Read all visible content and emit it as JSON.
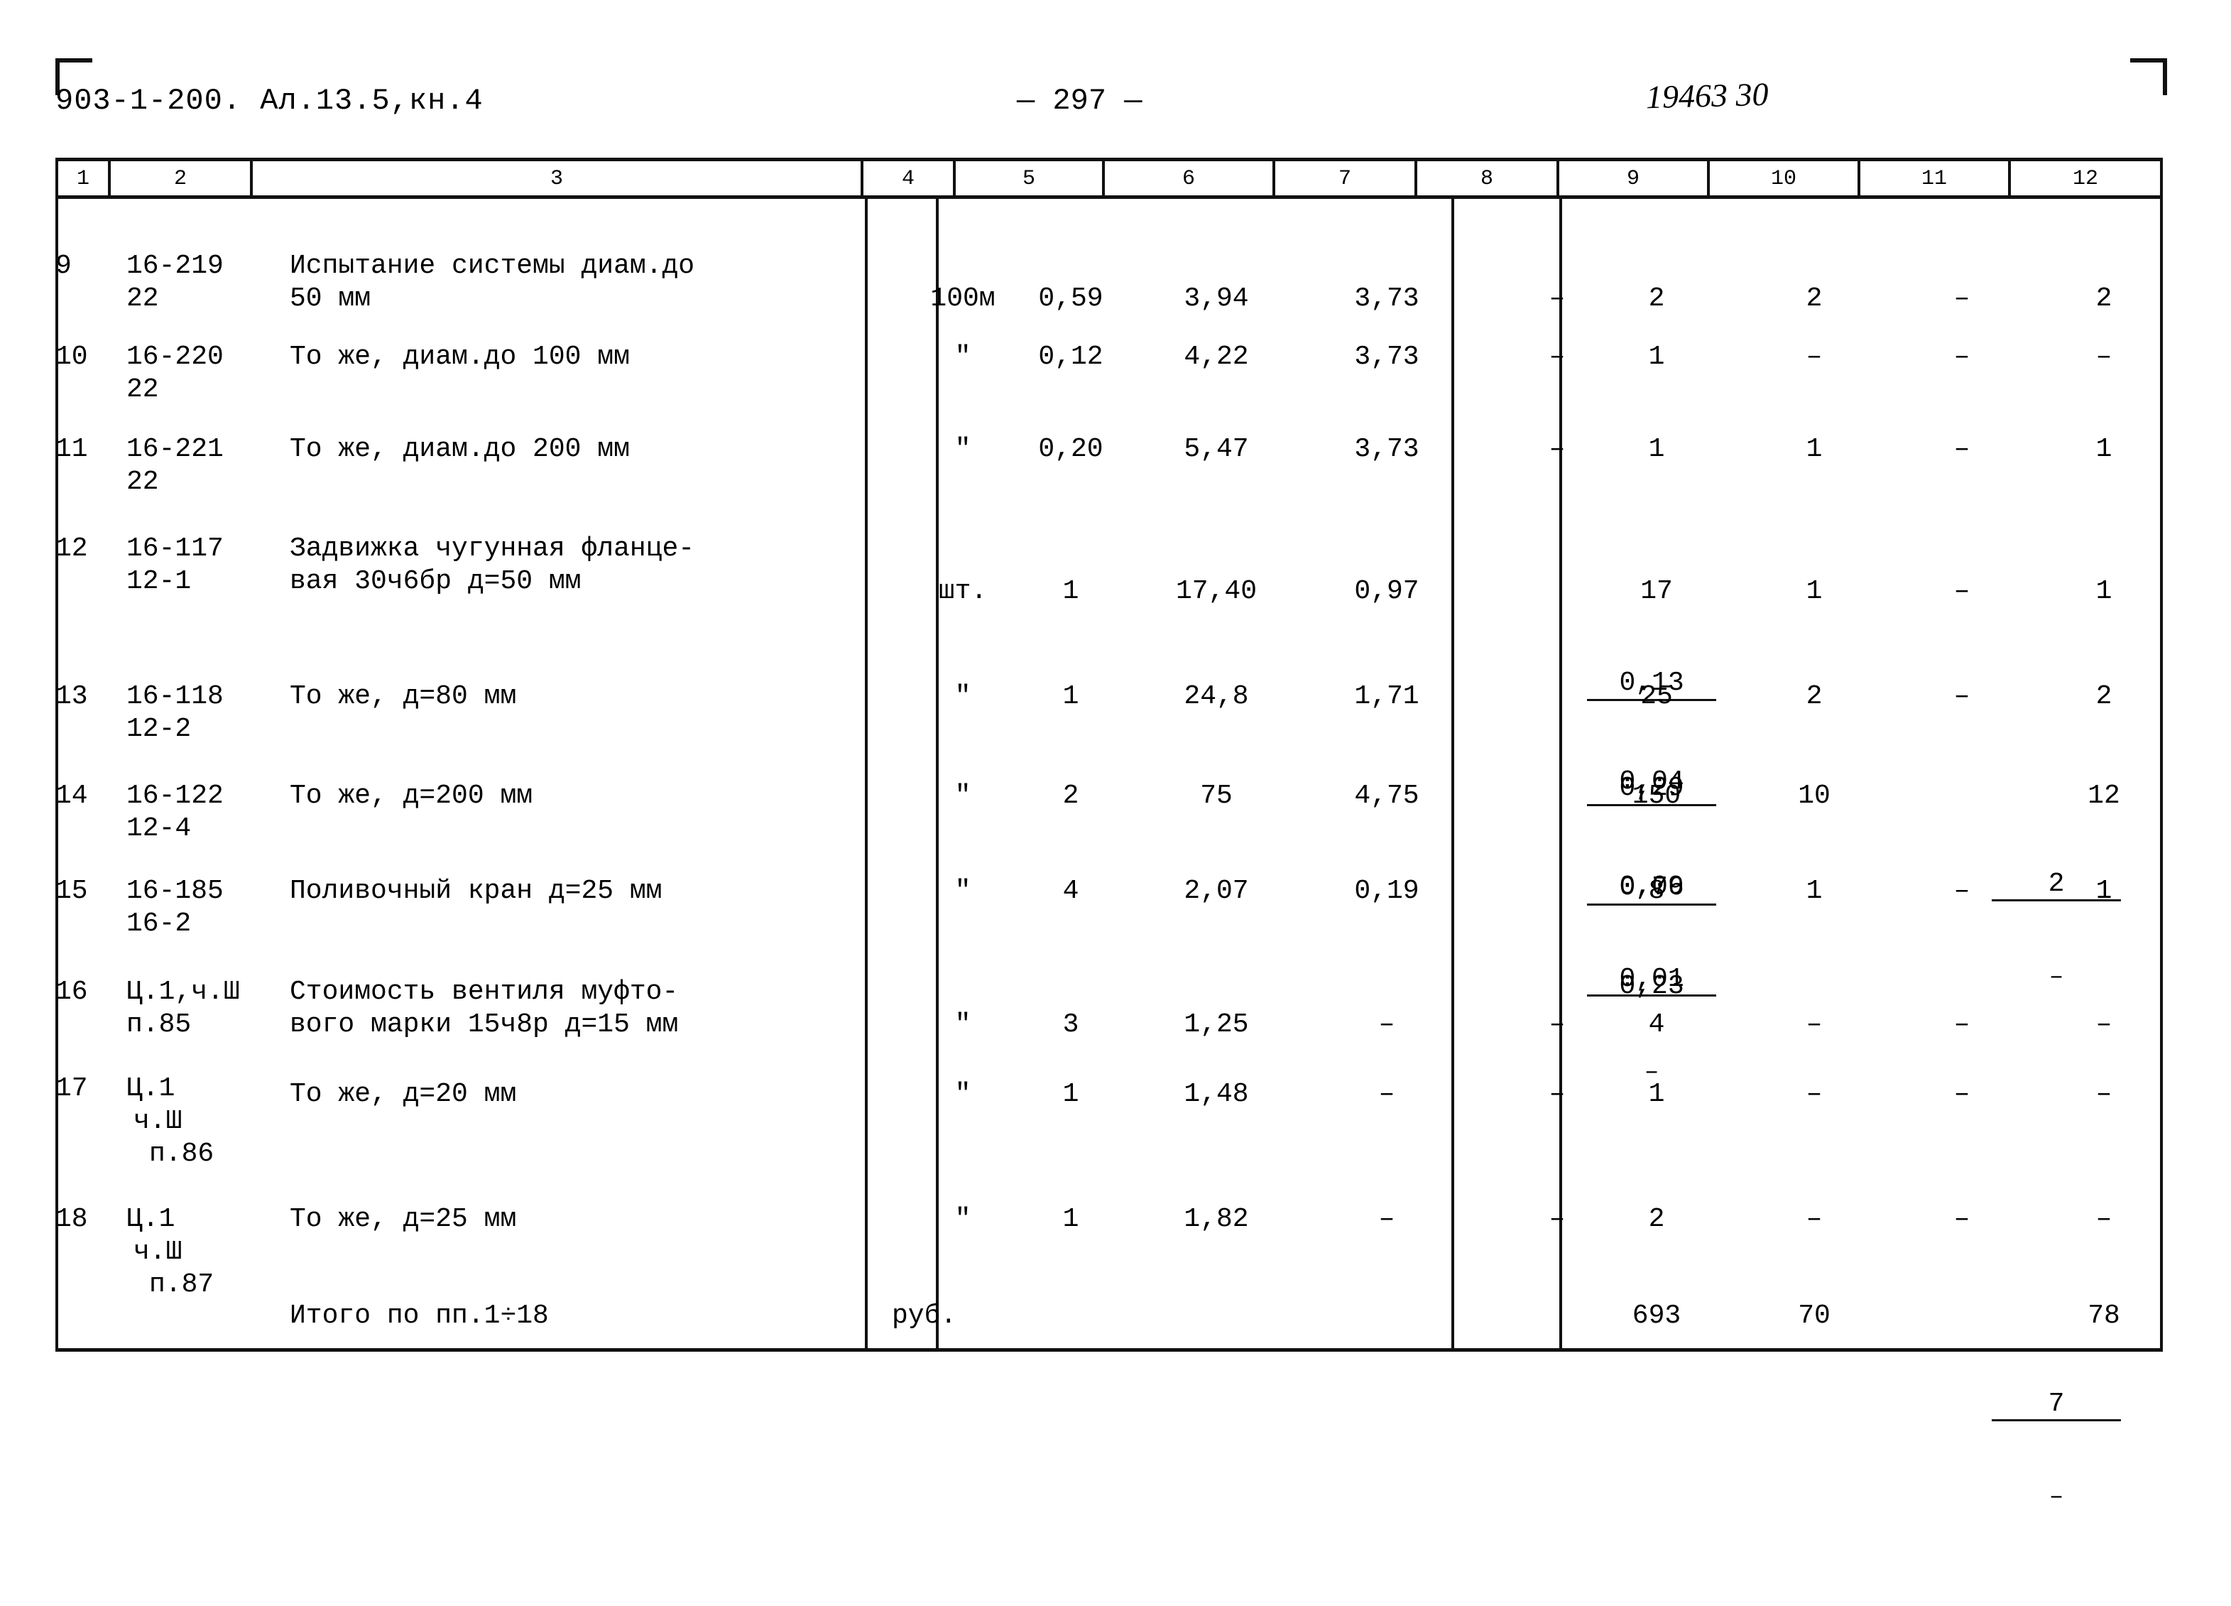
{
  "header": {
    "doc_code": "903-1-200. Ал.13.5,кн.4",
    "page_label": "— 297 —",
    "stamp": "19463 30"
  },
  "table": {
    "column_numbers": [
      "1",
      "2",
      "3",
      "4",
      "5",
      "6",
      "7",
      "8",
      "9",
      "10",
      "11",
      "12"
    ],
    "rows": [
      {
        "num": "9",
        "code_line1": "16-219",
        "code_line2": "22",
        "name_line1": "Испытание системы диам.до",
        "name_line2": "50 мм",
        "unit": "100м",
        "c5": "0,59",
        "c6": "3,94",
        "c7": "3,73",
        "c8_top": "",
        "c8_bot": "",
        "c8": "–",
        "c9": "2",
        "c10": "2",
        "c11": "–",
        "c12": "2"
      },
      {
        "num": "10",
        "code_line1": "16-220",
        "code_line2": "22",
        "name_line1": "То же, диам.до 100 мм",
        "name_line2": "",
        "unit": "\"",
        "c5": "0,12",
        "c6": "4,22",
        "c7": "3,73",
        "c8": "–",
        "c9": "1",
        "c10": "–",
        "c11": "–",
        "c12": "–"
      },
      {
        "num": "11",
        "code_line1": "16-221",
        "code_line2": "22",
        "name_line1": "То же, диам.до 200 мм",
        "name_line2": "",
        "unit": "\"",
        "c5": "0,20",
        "c6": "5,47",
        "c7": "3,73",
        "c8": "–",
        "c9": "1",
        "c10": "1",
        "c11": "–",
        "c12": "1"
      },
      {
        "num": "12",
        "code_line1": "16-117",
        "code_line2": "12-1",
        "name_line1": "Задвижка чугунная фланце-",
        "name_line2": "вая 30ч6бр д=50 мм",
        "unit": "шт.",
        "c5": "1",
        "c6": "17,40",
        "c7": "0,97",
        "c8_top": "0,13",
        "c8_bot": "0,04",
        "c9": "17",
        "c10": "1",
        "c11": "–",
        "c12": "1"
      },
      {
        "num": "13",
        "code_line1": "16-118",
        "code_line2": "12-2",
        "name_line1": "То же, д=80 мм",
        "name_line2": "",
        "unit": "\"",
        "c5": "1",
        "c6": "24,8",
        "c7": "1,71",
        "c8_top": "0,29",
        "c8_bot": "0,09",
        "c9": "25",
        "c10": "2",
        "c11": "–",
        "c12": "2"
      },
      {
        "num": "14",
        "code_line1": "16-122",
        "code_line2": "12-4",
        "name_line1": "То же, д=200 мм",
        "name_line2": "",
        "unit": "\"",
        "c5": "2",
        "c6": "75",
        "c7": "4,75",
        "c8_top": "0,76",
        "c8_bot": "0,23",
        "c9": "150",
        "c10": "10",
        "c11_top": "2",
        "c11_bot": "–",
        "c12": "12"
      },
      {
        "num": "15",
        "code_line1": "16-185",
        "code_line2": "16-2",
        "name_line1": "Поливочный кран д=25 мм",
        "name_line2": "",
        "unit": "\"",
        "c5": "4",
        "c6": "2,07",
        "c7": "0,19",
        "c8_top": "0,01",
        "c8_bot": "–",
        "c9": "8",
        "c10": "1",
        "c11": "–",
        "c12": "1"
      },
      {
        "num": "16",
        "code_line1": "Ц.1,ч.Ш",
        "code_line2": "п.85",
        "name_line1": "Стоимость вентиля муфто-",
        "name_line2": "вого марки 15ч8р д=15 мм",
        "unit": "\"",
        "c5": "3",
        "c6": "1,25",
        "c7": "–",
        "c8": "–",
        "c9": "4",
        "c10": "–",
        "c11": "–",
        "c12": "–"
      },
      {
        "num": "17",
        "code_line1": "Ц.1",
        "code_line2": "ч.Ш",
        "code_line3": "п.86",
        "name_line1": "То же, д=20 мм",
        "name_line2": "",
        "unit": "\"",
        "c5": "1",
        "c6": "1,48",
        "c7": "–",
        "c8": "–",
        "c9": "1",
        "c10": "–",
        "c11": "–",
        "c12": "–"
      },
      {
        "num": "18",
        "code_line1": "Ц.1",
        "code_line2": "ч.Ш",
        "code_line3": "п.87",
        "name_line1": "То же, д=25 мм",
        "name_line2": "",
        "unit": "\"",
        "c5": "1",
        "c6": "1,82",
        "c7": "–",
        "c8": "–",
        "c9": "2",
        "c10": "–",
        "c11": "–",
        "c12": "–"
      }
    ],
    "total_row": {
      "name": "Итого по пп.1÷18",
      "unit": "руб.",
      "c9": "693",
      "c10": "70",
      "c11_top": "7",
      "c11_bot": "–",
      "c12": "78"
    }
  }
}
